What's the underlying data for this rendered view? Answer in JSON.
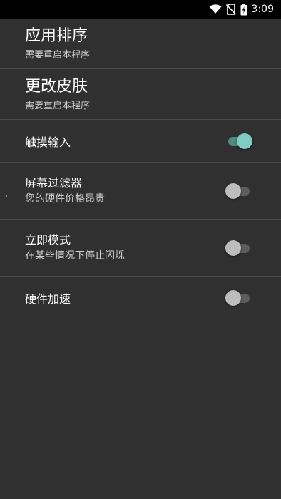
{
  "status_bar": {
    "time": "3:09",
    "icons": [
      "wifi-icon",
      "no-sim-icon",
      "battery-charging-icon"
    ]
  },
  "items": [
    {
      "title": "应用排序",
      "subtitle": "需要重启本程序"
    },
    {
      "title": "更改皮肤",
      "subtitle": "需要重启本程序"
    },
    {
      "title": "触摸输入",
      "toggle": true
    },
    {
      "title": "屏幕过滤器",
      "subtitle": "您的硬件价格昂贵",
      "toggle": false
    },
    {
      "title": "立即模式",
      "subtitle": "在某些情况下停止闪烁",
      "toggle": false
    },
    {
      "title": "硬件加速",
      "toggle": false
    }
  ],
  "colors": {
    "background": "#303030",
    "divider": "#4a4a4a",
    "toggle_on_thumb": "#80cbc4",
    "toggle_on_track": "#4f8a83",
    "toggle_off_thumb": "#bdbdbd",
    "toggle_off_track": "#5d5d5d"
  }
}
